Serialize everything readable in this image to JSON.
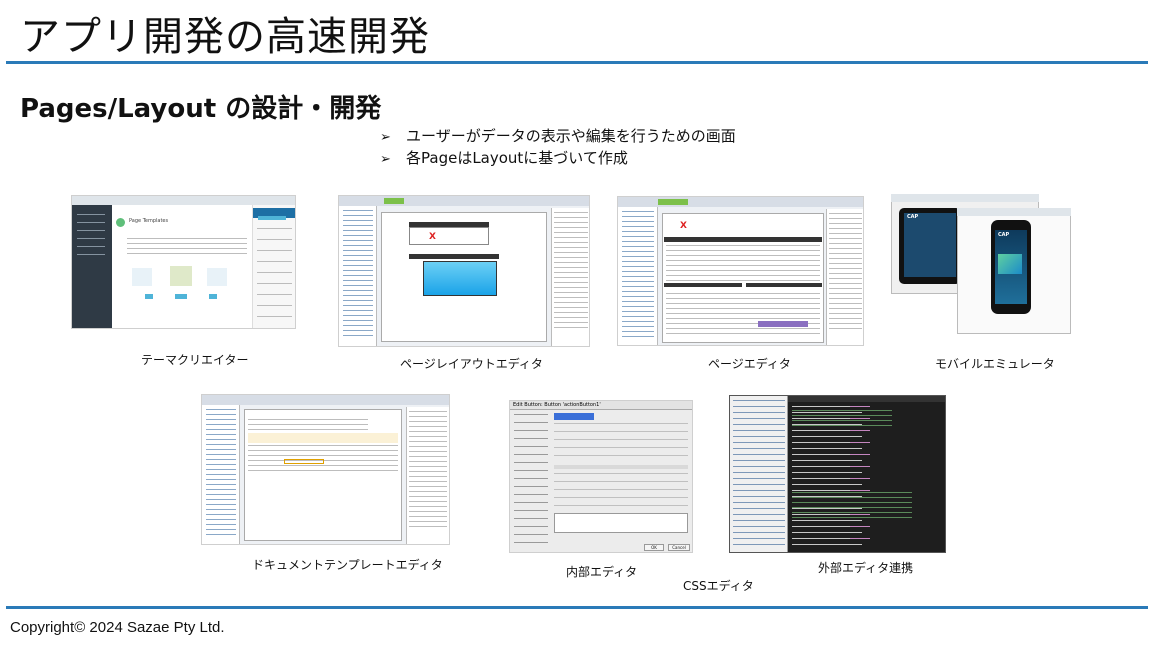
{
  "slide": {
    "title": "アプリ開発の高速開発",
    "subtitle": "Pages/Layout の設計・開発",
    "bullets": [
      "ユーザーがデータの表示や編集を行うための画面",
      "各PageはLayoutに基づいて作成"
    ],
    "bullet_icon": "arrow-right-icon",
    "accent_color": "#2a7ab8"
  },
  "screenshots": [
    {
      "caption": "テーマクリエイター",
      "header_text": "Page Templates"
    },
    {
      "caption": "ページレイアウトエディタ",
      "mark": "X"
    },
    {
      "caption": "ページエディタ",
      "mark": "X"
    },
    {
      "caption": "モバイルエミュレータ",
      "brand": "CAP"
    },
    {
      "caption": "ドキュメントテンプレートエディタ"
    },
    {
      "caption": "内部エディタ",
      "window_title": "Edit Button: Button 'actionButton1'",
      "ok_label": "OK",
      "cancel_label": "Cancel"
    },
    {
      "caption": "CSSエディタ"
    },
    {
      "caption": "外部エディタ連携"
    }
  ],
  "footer": {
    "copyright": "Copyright© 2024 Sazae Pty Ltd."
  }
}
